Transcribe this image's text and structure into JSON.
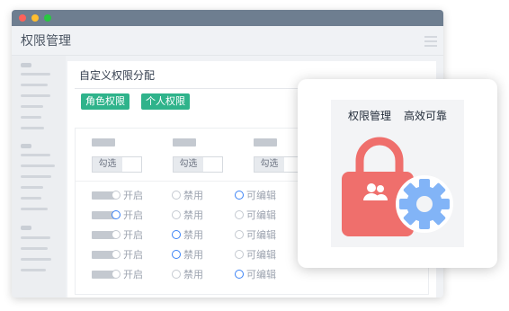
{
  "app": {
    "title": "权限管理"
  },
  "content": {
    "title": "自定义权限分配",
    "tags": [
      "角色权限",
      "个人权限"
    ]
  },
  "columns": [
    {
      "check_label": "勾选"
    },
    {
      "check_label": "勾选"
    },
    {
      "check_label": "勾选"
    }
  ],
  "options": {
    "open": "开启",
    "disabled": "禁用",
    "editable": "可编辑"
  },
  "rows": [
    {
      "selected": "editable"
    },
    {
      "selected": "open"
    },
    {
      "selected": "disabled"
    },
    {
      "selected": "disabled"
    },
    {
      "selected": "editable"
    }
  ],
  "popover": {
    "slogan_1": "权限管理",
    "slogan_2": "高效可靠"
  },
  "icons": {
    "lock": "lock-users-icon",
    "gear": "gear-icon"
  },
  "colors": {
    "titlebar": "#6e7e90",
    "tag": "#2fb38b",
    "lock": "#ef6f6c",
    "gear": "#82b4f7",
    "radio_selected": "#3b82f6"
  }
}
